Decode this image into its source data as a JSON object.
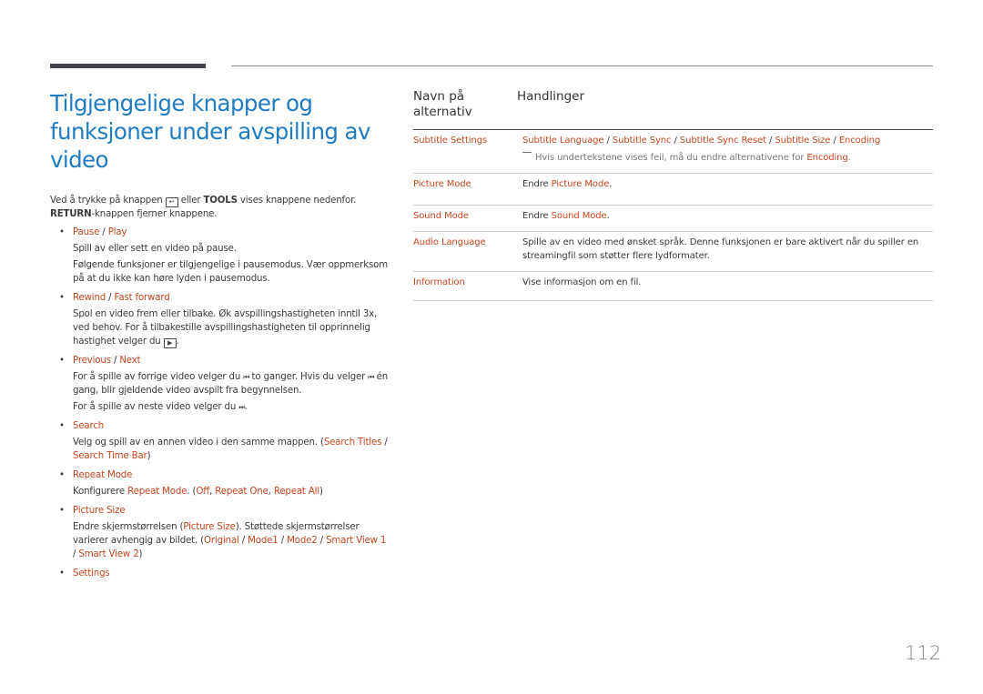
{
  "title": "Tilgjengelige knapper og funksjoner under avspilling av video",
  "intro": {
    "part1": "Ved å trykke på knappen ",
    "icon": "tools-button-icon",
    "part2": " eller ",
    "tools": "TOOLS",
    "part3": " vises knappene nedenfor.",
    "return": "RETURN",
    "part4": "-knappen fjerner knappene."
  },
  "items": [
    {
      "head_a": "Pause",
      "sep": " / ",
      "head_b": "Play",
      "p1": "Spill av eller sett en video på pause.",
      "p2": "Følgende funksjoner er tilgjengelige i pausemodus. Vær oppmerksom på at du ikke kan høre lyden i pausemodus."
    },
    {
      "head_a": "Rewind",
      "sep": " / ",
      "head_b": "Fast forward",
      "p1a": "Spol en video frem eller tilbake. Øk avspillingshastigheten inntil 3x, ved behov. For å tilbakestille avspillingshastigheten til opprinnelig hastighet velger du ",
      "p1b": "."
    },
    {
      "head_a": "Previous",
      "sep": " / ",
      "head_b": "Next",
      "p1a": "For å spille av forrige video velger du ",
      "p1b": " to ganger. Hvis du velger ",
      "p1c": " én gang, blir gjeldende video avspilt fra begynnelsen.",
      "p2a": "For å spille av neste video velger du ",
      "p2b": "."
    },
    {
      "head": "Search",
      "p1a": "Velg og spill av en annen video i den samme mappen. (",
      "l1": "Search Titles",
      "s1": " / ",
      "l2": "Search Time Bar",
      "p1b": ")"
    },
    {
      "head": "Repeat Mode",
      "p1a": "Konfigurere ",
      "l1": "Repeat Mode",
      "p1b": ". (",
      "l2": "Off",
      "s": ", ",
      "l3": "Repeat One",
      "l4": "Repeat All",
      "p1c": ")"
    },
    {
      "head": "Picture Size",
      "p1a": "Endre skjermstørrelsen (",
      "l1": "Picture Size",
      "p1b": "). Støttede skjermstørrelser varierer avhengig av bildet. (",
      "l2": "Original",
      "l3": "Mode1",
      "l4": "Mode2",
      "l5": "Smart View 1",
      "l6": "Smart View 2",
      "s": " / ",
      "p1c": ")"
    },
    {
      "head": "Settings"
    }
  ],
  "table": {
    "header": {
      "col1": "Navn på alternativ",
      "col2": "Handlinger"
    },
    "rows": [
      {
        "name": "Subtitle Settings",
        "opts": [
          "Subtitle Language",
          "Subtitle Sync",
          "Subtitle Sync Reset",
          "Subtitle Size",
          "Encoding"
        ],
        "sep": " / ",
        "note_a": "Hvis undertekstene vises feil, må du endre alternativene for ",
        "note_link": "Encoding",
        "note_b": "."
      },
      {
        "name": "Picture Mode",
        "a": "Endre ",
        "link": "Picture Mode",
        "b": "."
      },
      {
        "name": "Sound Mode",
        "a": "Endre ",
        "link": "Sound Mode",
        "b": "."
      },
      {
        "name": "Audio Language",
        "text": "Spille av en video med ønsket språk. Denne funksjonen er bare aktivert når du spiller en streamingfil som støtter flere lydformater."
      },
      {
        "name": "Information",
        "text": "Vise informasjon om en fil."
      }
    ]
  },
  "page_number": "112",
  "colors": {
    "title": "#1f7cc0",
    "accent": "#c3461d"
  }
}
